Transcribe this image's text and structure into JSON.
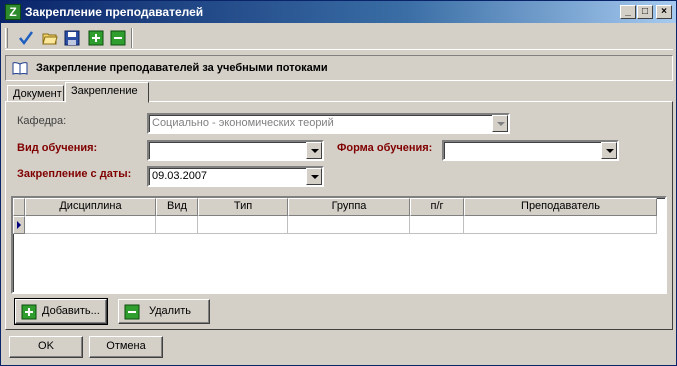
{
  "window": {
    "title": "Закрепление преподавателей",
    "app_icon_glyph": "Z",
    "controls": {
      "minimize": "_",
      "maximize": "□",
      "close": "×"
    }
  },
  "toolbar": {
    "icons": [
      "checkmark-icon",
      "open-folder-icon",
      "save-icon",
      "add-icon",
      "remove-icon"
    ]
  },
  "header": {
    "icon": "book-icon",
    "text": "Закрепление преподавателей за учебными потоками"
  },
  "tabs": [
    {
      "label": "Документ",
      "active": false
    },
    {
      "label": "Закрепление",
      "active": true
    }
  ],
  "form": {
    "kafedra_label": "Кафедра:",
    "kafedra_value": "Социально - экономических теорий",
    "vid_label": "Вид обучения:",
    "vid_value": "",
    "forma_label": "Форма обучения:",
    "forma_value": "",
    "date_label": "Закрепление с даты:",
    "date_value": "09.03.2007"
  },
  "grid": {
    "columns": [
      "Дисциплина",
      "Вид",
      "Тип",
      "Группа",
      "п/г",
      "Преподаватель"
    ],
    "rows": [
      [
        "",
        "",
        "",
        "",
        "",
        ""
      ]
    ]
  },
  "buttons": {
    "add": "Добавить...",
    "delete": "Удалить",
    "ok": "OK",
    "cancel": "Отмена"
  },
  "colors": {
    "title_start": "#0a246a",
    "title_end": "#a6caf0",
    "required_label": "#800000",
    "face": "#d4d0c8"
  }
}
